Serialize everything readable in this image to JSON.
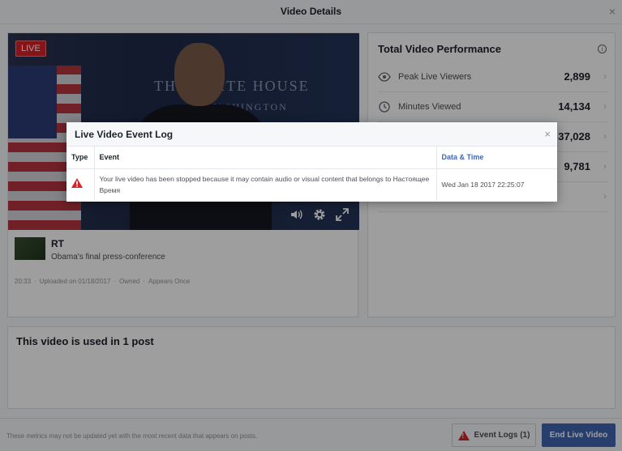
{
  "header": {
    "title": "Video Details",
    "close": "×"
  },
  "player": {
    "live_badge": "LIVE",
    "backdrop_text_1": "THE WHITE HOUSE",
    "backdrop_text_2": "WASHINGTON",
    "controls": [
      "volume-icon",
      "settings-icon",
      "fullscreen-icon"
    ]
  },
  "video": {
    "channel": "RT",
    "title": "Obama's final press-conference",
    "meta": [
      "20:33",
      "·",
      "Uploaded on 01/18/2017",
      "·",
      "Owned",
      "·",
      "Appears Once"
    ]
  },
  "performance": {
    "title": "Total Video Performance",
    "metrics": [
      {
        "icon": "eye-icon",
        "label": "Peak Live Viewers",
        "value": "2,899"
      },
      {
        "icon": "clock-icon",
        "label": "Minutes Viewed",
        "value": "14,134"
      },
      {
        "icon": "",
        "label": "",
        "value": "37,028"
      },
      {
        "icon": "",
        "label": "",
        "value": "9,781"
      },
      {
        "icon": "",
        "label": "",
        "value": ""
      }
    ]
  },
  "posts": {
    "title": "This video is used in 1 post"
  },
  "footer": {
    "note": "These metrics may not be updated yet with the most recent data that appears on posts.",
    "event_logs_label": "Event Logs (1)",
    "end_live_label": "End Live Video"
  },
  "dialog": {
    "title": "Live Video Event Log",
    "close": "×",
    "columns": {
      "type": "Type",
      "event": "Event",
      "datetime": "Data & Time"
    },
    "rows": [
      {
        "type_icon": "warning-icon",
        "event": "Your live video has been stopped because it may contain audio or visual content that belongs to Настоящее Время",
        "datetime": "Wed Jan 18 2017 22:25:07"
      }
    ]
  },
  "colors": {
    "accent": "#4267b2",
    "danger": "#d8232a"
  }
}
